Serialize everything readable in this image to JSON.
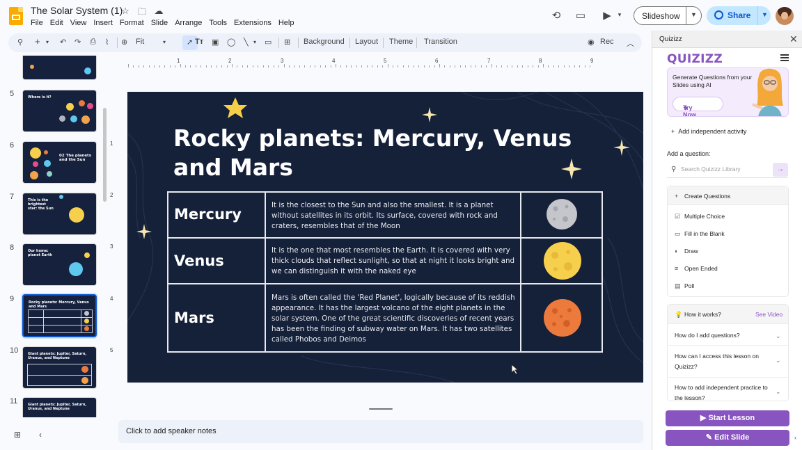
{
  "doc": {
    "title": "The Solar System (1)"
  },
  "menu": [
    "File",
    "Edit",
    "View",
    "Insert",
    "Format",
    "Slide",
    "Arrange",
    "Tools",
    "Extensions",
    "Help"
  ],
  "header": {
    "slideshow_label": "Slideshow",
    "share_label": "Share"
  },
  "toolbar": {
    "zoom": "Fit",
    "background": "Background",
    "layout": "Layout",
    "theme": "Theme",
    "transition": "Transition",
    "rec": "Rec"
  },
  "filmstrip": {
    "slides": [
      {
        "num": "",
        "title": ""
      },
      {
        "num": "5",
        "title": "Where is it?"
      },
      {
        "num": "6",
        "title": "02 The planets and the Sun"
      },
      {
        "num": "7",
        "title": "This is the brightest star: the Sun"
      },
      {
        "num": "8",
        "title": "Our home: planet Earth"
      },
      {
        "num": "9",
        "title": "Rocky planets: Mercury, Venus and Mars"
      },
      {
        "num": "10",
        "title": "Giant planets: Jupiter, Saturn, Uranus, and Neptune"
      },
      {
        "num": "11",
        "title": "Giant planets: Jupiter, Saturn, Uranus, and Neptune"
      }
    ]
  },
  "ruler": {
    "h": [
      "1",
      "2",
      "3",
      "4",
      "5",
      "6",
      "7",
      "8",
      "9"
    ],
    "v": [
      "1",
      "2",
      "3",
      "4",
      "5"
    ]
  },
  "slide": {
    "title": "Rocky planets: Mercury, Venus and Mars",
    "rows": [
      {
        "name": "Mercury",
        "desc": "It is the closest to the Sun and also the smallest. It is a planet without satellites in its orbit. Its surface, covered with rock and craters, resembles that of the Moon",
        "color": "#c4c6cc"
      },
      {
        "name": "Venus",
        "desc": "It is the one that most resembles the Earth. It is covered with very thick clouds that reflect sunlight, so that at night it looks bright and we can distinguish it with the naked eye",
        "color": "#f6d04d"
      },
      {
        "name": "Mars",
        "desc": "Mars is often called the 'Red Planet', logically because of its reddish appearance. It has the largest volcano of the eight planets in the solar system. One of the great scientific discoveries of recent years has been the finding of subway water on Mars. It has two satellites called Phobos and Deimos",
        "color": "#ec7a3c"
      }
    ]
  },
  "notes": {
    "placeholder": "Click to add speaker notes"
  },
  "quizizz": {
    "panel_title": "Quizizz",
    "logo": "QUIZIZZ",
    "ai_card": {
      "text": "Generate Questions from your Slides using AI",
      "try_label": "Try Now"
    },
    "add_independent": "Add independent activity",
    "add_question_label": "Add a question:",
    "search_placeholder": "Search Quizizz Library",
    "create_label": "Create Questions",
    "options": [
      "Multiple Choice",
      "Fill in the Blank",
      "Draw",
      "Open Ended",
      "Poll"
    ],
    "how_title": "How it works?",
    "see_video": "See Video",
    "faqs": [
      "How do I add questions?",
      "How can I access this lesson on Quizizz?",
      "How to add independent practice to the lesson?"
    ],
    "start_lesson": "Start Lesson",
    "edit_slide": "Edit Slide"
  },
  "colors": {
    "accent": "#8854c0",
    "slide_bg": "#152039",
    "share_bg": "#c2e7ff"
  }
}
